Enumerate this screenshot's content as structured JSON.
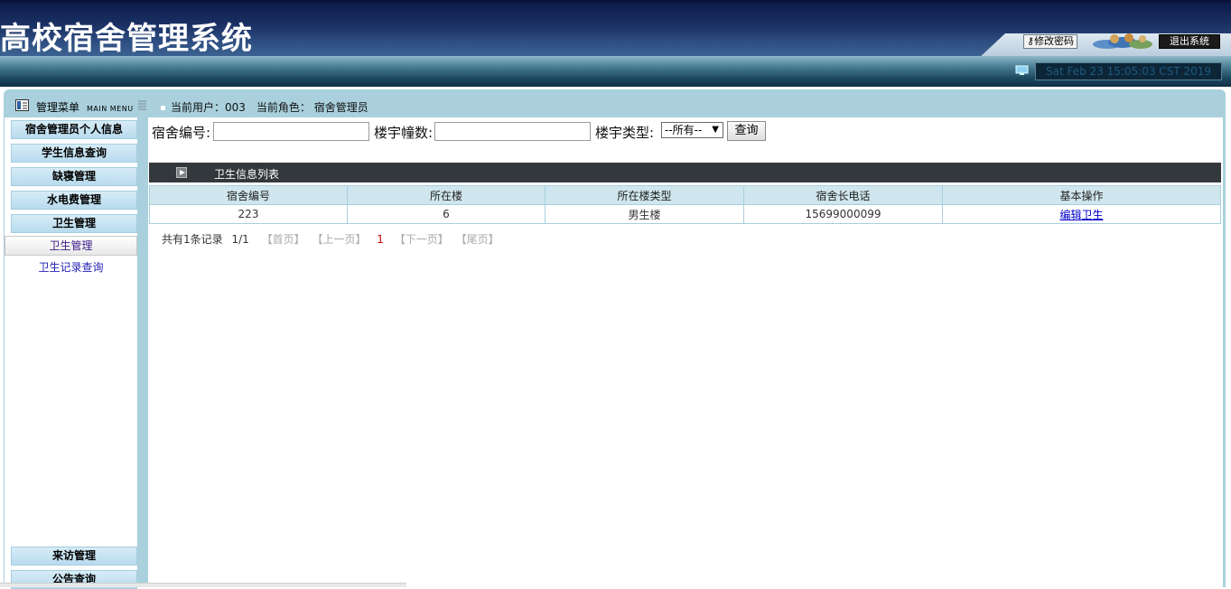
{
  "header": {
    "title": "高校宿舍管理系统",
    "change_password": "修改密码",
    "logout": "退出系统",
    "datetime": "Sat Feb 23 15:05:03 CST 2019"
  },
  "menu": {
    "title": "管理菜单",
    "title_en": "MAIN MENU",
    "items": [
      {
        "label": "宿舍管理员个人信息"
      },
      {
        "label": "学生信息查询"
      },
      {
        "label": "缺寝管理"
      },
      {
        "label": "水电费管理"
      },
      {
        "label": "卫生管理"
      }
    ],
    "sub_active": "卫生管理",
    "sub_item": "卫生记录查询",
    "bottom_items": [
      {
        "label": "来访管理"
      },
      {
        "label": "公告查询"
      }
    ]
  },
  "user_bar": {
    "current_user_label": "当前用户：003",
    "current_role_label": "当前角色： 宿舍管理员"
  },
  "search": {
    "dorm_no_label": "宿舍编号:",
    "dorm_no_value": "",
    "building_label": "楼宇幢数:",
    "building_value": "",
    "type_label": "楼宇类型:",
    "type_selected": "--所有--",
    "query_button": "查询"
  },
  "list": {
    "title": "卫生信息列表",
    "columns": [
      "宿舍编号",
      "所在楼",
      "所在楼类型",
      "宿舍长电话",
      "基本操作"
    ],
    "rows": [
      {
        "dorm_no": "223",
        "building": "6",
        "building_type": "男生楼",
        "phone": "15699000099",
        "action": "编辑卫生"
      }
    ]
  },
  "pager": {
    "total": "共有1条记录",
    "page": "1/1",
    "first": "【首页】",
    "prev": "【上一页】",
    "current": "1",
    "next": "【下一页】",
    "last": "【尾页】"
  }
}
